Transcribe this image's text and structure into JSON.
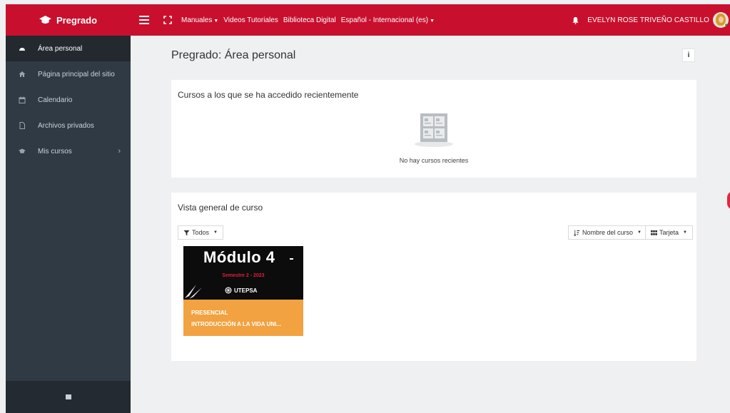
{
  "navbar": {
    "brand": "Pregrado",
    "links": [
      {
        "label": "Manuales",
        "dropdown": true
      },
      {
        "label": "Videos Tutoriales",
        "dropdown": false
      },
      {
        "label": "Biblioteca Digital",
        "dropdown": false
      },
      {
        "label": "Español - Internacional (es)",
        "dropdown": true
      }
    ],
    "user_name": "EVELYN ROSE TRIVEÑO CASTILLO",
    "brand_color": "#c8102e"
  },
  "sidebar": {
    "items": [
      {
        "label": "Área personal",
        "icon": "dashboard-icon",
        "active": true
      },
      {
        "label": "Página principal del sitio",
        "icon": "home-icon",
        "active": false
      },
      {
        "label": "Calendario",
        "icon": "calendar-icon",
        "active": false
      },
      {
        "label": "Archivos privados",
        "icon": "file-icon",
        "active": false
      },
      {
        "label": "Mis cursos",
        "icon": "graduation-cap-icon",
        "active": false,
        "has_children": true
      }
    ]
  },
  "main": {
    "page_title": "Pregrado: Área personal",
    "recent": {
      "title": "Cursos a los que se ha accedido recientemente",
      "empty_text": "No hay cursos recientes"
    },
    "overview": {
      "title": "Vista general de curso",
      "filter_label": "Todos",
      "sort_label": "Nombre del curso",
      "view_label": "Tarjeta",
      "courses": [
        {
          "image_title": "Módulo 4",
          "image_subtitle": "Semestre 2 - 2023",
          "image_logo": "UTEPSA",
          "category": "PRESENCIAL",
          "name": "INTRODUCCIÓN A LA VIDA UNI..."
        }
      ]
    }
  }
}
